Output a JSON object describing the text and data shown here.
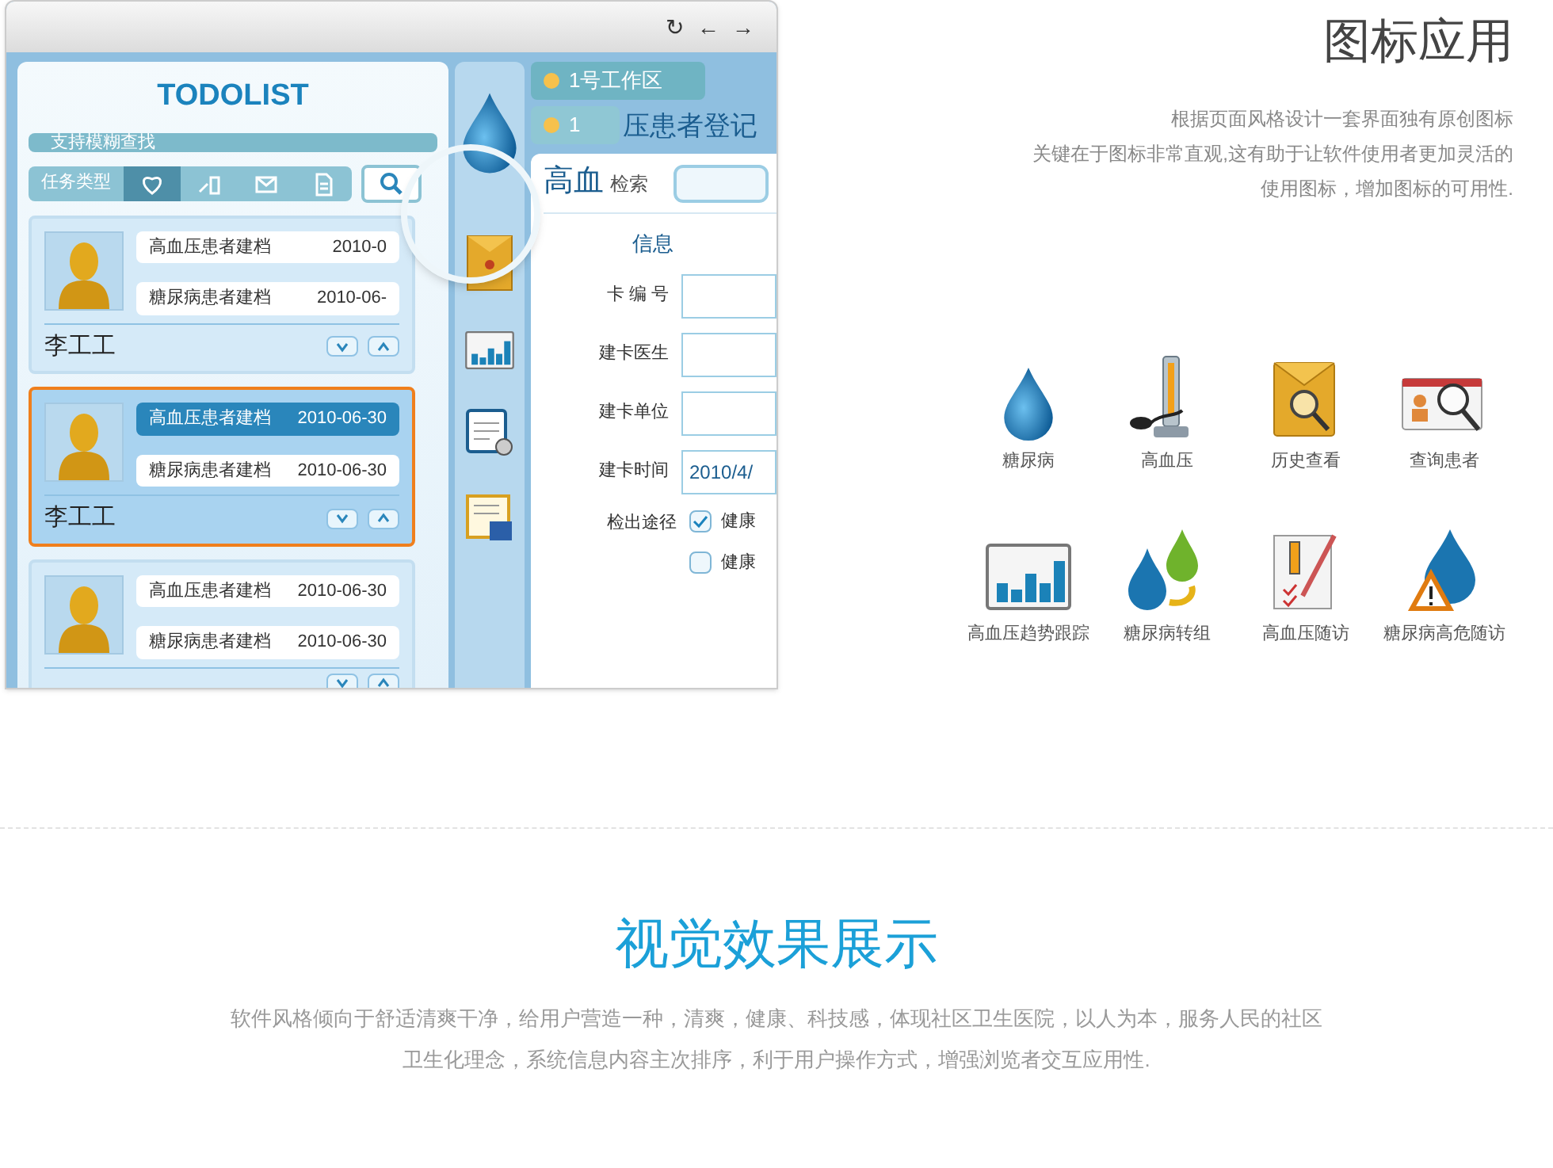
{
  "app_window": {
    "toolbar": [
      "↻",
      "←",
      "→"
    ],
    "todolist": {
      "title": "TODOLIST",
      "search": {
        "placeholder": "支持模糊查找"
      },
      "task_types": {
        "label": "任务类型",
        "tabs": [
          {
            "selected": true
          },
          {
            "selected": false
          },
          {
            "selected": false
          },
          {
            "selected": false
          }
        ]
      },
      "cards": [
        {
          "name": "李工工",
          "selected": false,
          "rows": [
            {
              "title": "高血压患者建档",
              "date": "2010-0",
              "selected": false
            },
            {
              "title": "糖尿病患者建档",
              "date": "2010-06-",
              "selected": false
            }
          ]
        },
        {
          "name": "李工工",
          "selected": true,
          "rows": [
            {
              "title": "高血压患者建档",
              "date": "2010-06-30",
              "selected": true
            },
            {
              "title": "糖尿病患者建档",
              "date": "2010-06-30",
              "selected": false
            }
          ]
        },
        {
          "selected": false,
          "rows": [
            {
              "title": "高血压患者建档",
              "date": "2010-06-30",
              "selected": false
            },
            {
              "title": "糖尿病患者建档",
              "date": "2010-06-30",
              "selected": false
            }
          ]
        }
      ]
    },
    "workspace": {
      "tabs": [
        {
          "label": "1号工作区",
          "selected": true
        },
        {
          "label": "1",
          "selected": false
        }
      ],
      "page_title": "压患者登记",
      "form": {
        "heading": "高血",
        "search_label": "检索",
        "section": "信息",
        "fields": [
          {
            "label": "卡 编 号"
          },
          {
            "label": "建卡医生"
          },
          {
            "label": "建卡单位"
          },
          {
            "label": "建卡时间",
            "value": "2010/4/"
          }
        ],
        "route_label": "检出途径",
        "checks": [
          {
            "label": "健康",
            "checked": true
          },
          {
            "label": "健康",
            "checked": false
          }
        ]
      }
    }
  },
  "icon_section": {
    "title": "图标应用",
    "lines": [
      "根据页面风格设计一套界面独有原创图标",
      "关键在于图标非常直观,这有助于让软件使用者更加灵活的",
      "使用图标，增加图标的可用性."
    ],
    "icons": [
      "糖尿病",
      "高血压",
      "历史查看",
      "查询患者",
      "高血压趋势跟踪",
      "糖尿病转组",
      "高血压随访",
      "糖尿病高危随访"
    ]
  },
  "visual_section": {
    "title": "视觉效果展示",
    "lines": [
      "软件风格倾向于舒适清爽干净，给用户营造一种，清爽，健康、科技感，体现社区卫生医院，以人为本，服务人民的社区",
      "卫生化理念，系统信息内容主次排序，利于用户操作方式，增强浏览者交互应用性."
    ]
  }
}
